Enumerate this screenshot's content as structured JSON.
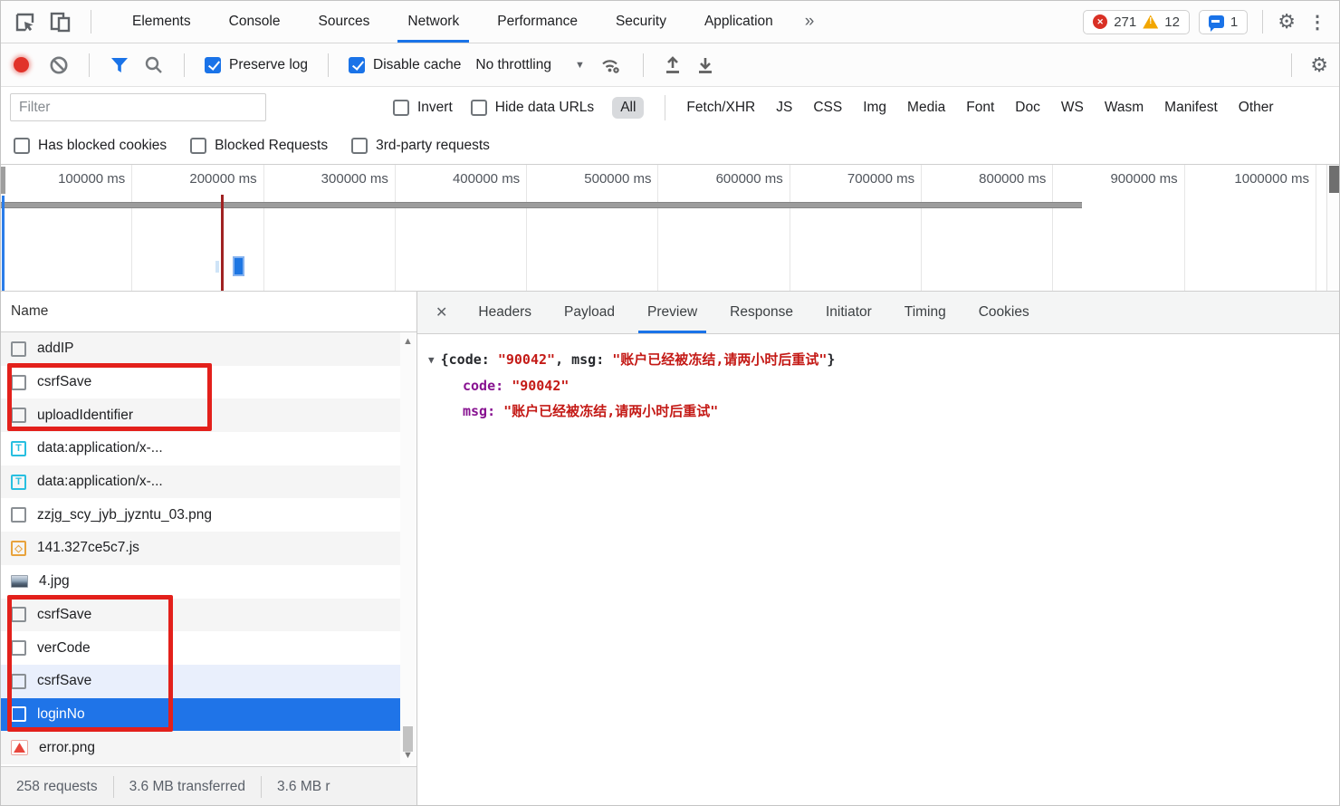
{
  "top_bar": {
    "tabs": [
      "Elements",
      "Console",
      "Sources",
      "Network",
      "Performance",
      "Security",
      "Application"
    ],
    "active_tab": "Network",
    "more_tabs_symbol": "»",
    "error_count": "271",
    "warning_count": "12",
    "issue_count": "1"
  },
  "toolbar": {
    "preserve_log_label": "Preserve log",
    "disable_cache_label": "Disable cache",
    "throttling_value": "No throttling"
  },
  "filter_bar": {
    "input_placeholder": "Filter",
    "invert_label": "Invert",
    "hide_data_urls_label": "Hide data URLs",
    "type_filters": [
      "All",
      "Fetch/XHR",
      "JS",
      "CSS",
      "Img",
      "Media",
      "Font",
      "Doc",
      "WS",
      "Wasm",
      "Manifest",
      "Other"
    ],
    "active_type": "All"
  },
  "options_bar": {
    "has_blocked_cookies_label": "Has blocked cookies",
    "blocked_requests_label": "Blocked Requests",
    "third_party_label": "3rd-party requests"
  },
  "timeline": {
    "ticks": [
      "100000 ms",
      "200000 ms",
      "300000 ms",
      "400000 ms",
      "500000 ms",
      "600000 ms",
      "700000 ms",
      "800000 ms",
      "900000 ms",
      "1000000 ms"
    ]
  },
  "request_list": {
    "column_header": "Name",
    "rows": [
      {
        "name": "addIP",
        "icon": "plain-icon"
      },
      {
        "name": "csrfSave",
        "icon": "plain-icon"
      },
      {
        "name": "uploadIdentifier",
        "icon": "plain-icon"
      },
      {
        "name": "data:application/x-...",
        "icon": "text-icon"
      },
      {
        "name": "data:application/x-...",
        "icon": "text-icon"
      },
      {
        "name": "zzjg_scy_jyb_jyzntu_03.png",
        "icon": "plain-icon"
      },
      {
        "name": "141.327ce5c7.js",
        "icon": "script-icon"
      },
      {
        "name": "4.jpg",
        "icon": "image-icon"
      },
      {
        "name": "csrfSave",
        "icon": "plain-icon"
      },
      {
        "name": "verCode",
        "icon": "plain-icon"
      },
      {
        "name": "csrfSave",
        "icon": "plain-icon"
      },
      {
        "name": "loginNo",
        "icon": "plain-icon",
        "selected": true
      },
      {
        "name": "error.png",
        "icon": "warning-icon"
      }
    ]
  },
  "details_pane": {
    "close_symbol": "✕",
    "tabs": [
      "Headers",
      "Payload",
      "Preview",
      "Response",
      "Initiator",
      "Timing",
      "Cookies"
    ],
    "active_tab": "Preview",
    "preview": {
      "summary": {
        "open_brace": "{",
        "key1": "code: ",
        "value1": "\"90042\"",
        "separator": ", ",
        "key2": "msg: ",
        "value2": "\"账户已经被冻结,请两小时后重试\"",
        "close_brace": "}"
      },
      "entries": [
        {
          "key": "code: ",
          "value": "\"90042\""
        },
        {
          "key": "msg: ",
          "value": "\"账户已经被冻结,请两小时后重试\""
        }
      ]
    }
  },
  "status_bar": {
    "requests": "258 requests",
    "transferred": "3.6 MB transferred",
    "resources": "3.6 MB r"
  },
  "colors": {
    "accent_blue": "#1a73e8",
    "selection_blue": "#1f74e8",
    "annotation_red": "#e3201b",
    "error_red": "#d93025",
    "warning_yellow": "#f2a600",
    "json_key_purple": "#881391",
    "json_string_red": "#c41a16"
  }
}
